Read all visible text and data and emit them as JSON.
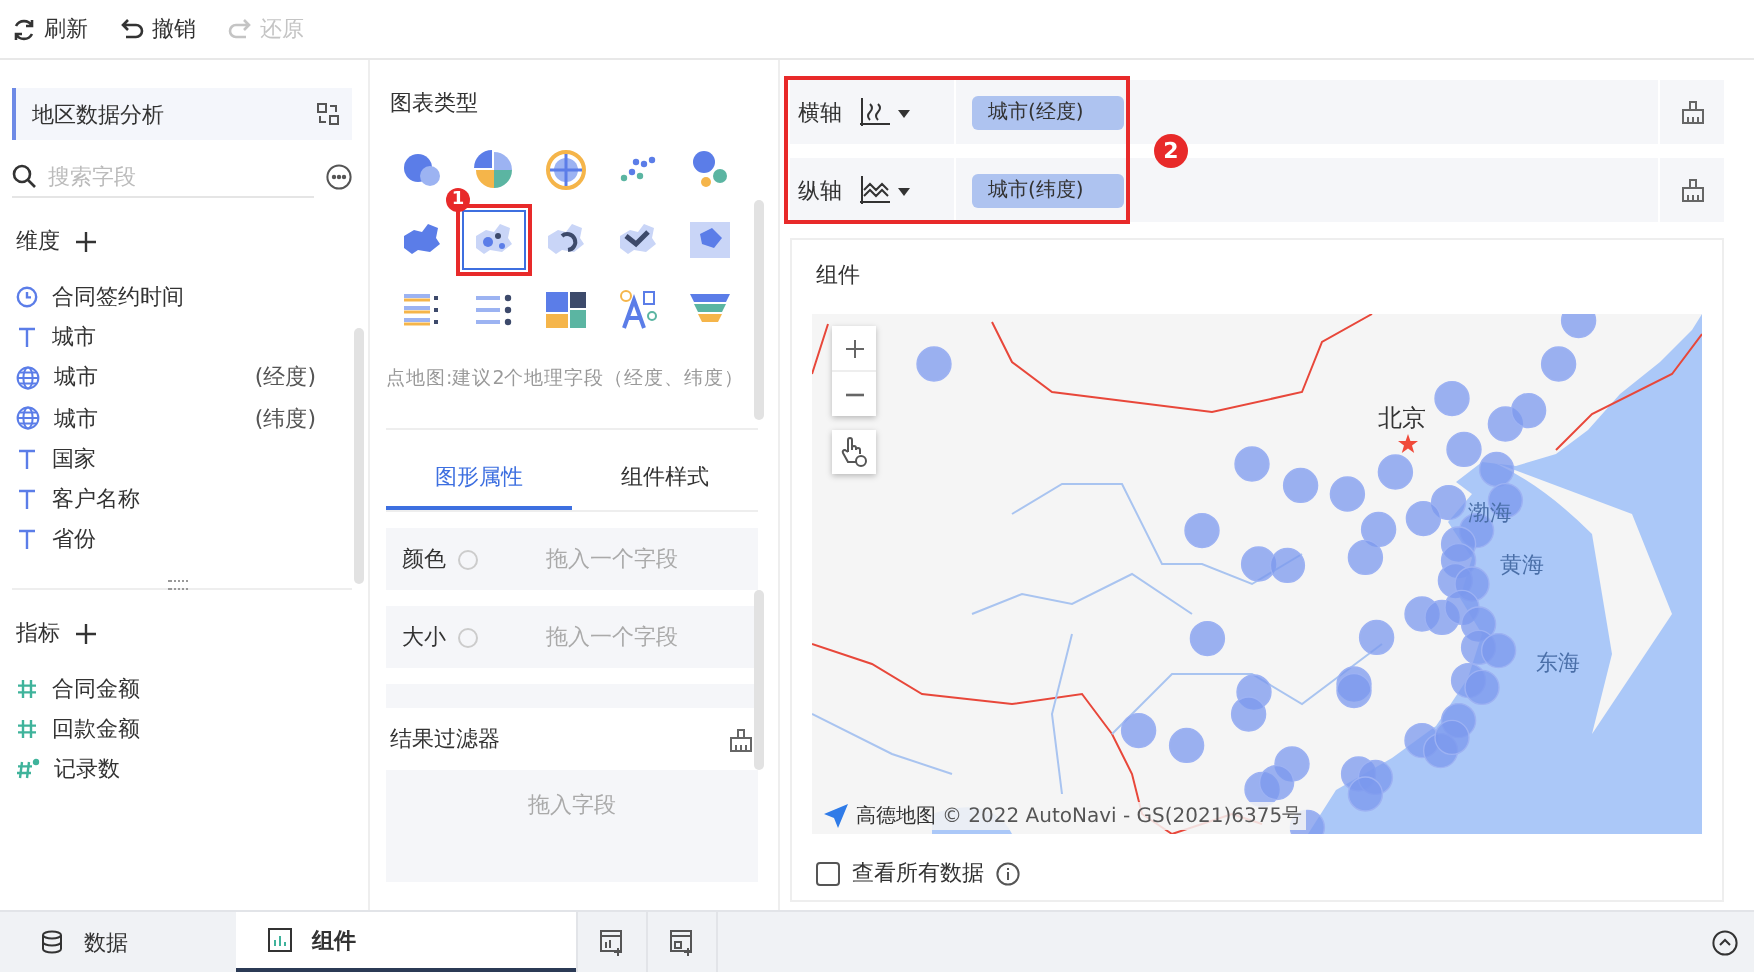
{
  "toolbar": {
    "buttons": [
      {
        "kind": "refresh",
        "label": "刷新",
        "disabled": false
      },
      {
        "kind": "undo",
        "label": "撤销",
        "disabled": false
      },
      {
        "kind": "redo",
        "label": "还原",
        "disabled": true
      }
    ]
  },
  "dataset": {
    "title": "地区数据分析"
  },
  "search": {
    "placeholder": "搜索字段"
  },
  "dimensions": {
    "title": "维度",
    "fields": [
      {
        "kind": "time",
        "name": "合同签约时间"
      },
      {
        "kind": "text",
        "name": "城市"
      },
      {
        "kind": "geo",
        "name": "城市",
        "suffix": "(经度)"
      },
      {
        "kind": "geo",
        "name": "城市",
        "suffix": "(纬度)"
      },
      {
        "kind": "text",
        "name": "国家"
      },
      {
        "kind": "text",
        "name": "客户名称"
      },
      {
        "kind": "text",
        "name": "省份"
      }
    ]
  },
  "measures": {
    "title": "指标",
    "fields": [
      {
        "kind": "number",
        "name": "合同金额"
      },
      {
        "kind": "number",
        "name": "回款金额"
      },
      {
        "kind": "count",
        "name": "记录数"
      }
    ]
  },
  "chart_types": {
    "title": "图表类型",
    "items": [
      {
        "selected": false
      },
      {
        "selected": false
      },
      {
        "selected": false
      },
      {
        "selected": false
      },
      {
        "selected": false
      },
      {
        "selected": false
      },
      {
        "selected": true
      },
      {
        "selected": false
      },
      {
        "selected": false
      },
      {
        "selected": false
      },
      {
        "selected": false
      },
      {
        "selected": false
      },
      {
        "selected": false
      },
      {
        "selected": false
      },
      {
        "selected": false
      }
    ],
    "hint": "点地图:建议2个地理字段（经度、纬度）"
  },
  "property_tabs": [
    {
      "label": "图形属性",
      "selected": true
    },
    {
      "label": "组件样式",
      "selected": false
    }
  ],
  "properties": [
    {
      "label": "颜色",
      "placeholder": "拖入一个字段"
    },
    {
      "label": "大小",
      "placeholder": "拖入一个字段"
    }
  ],
  "filter": {
    "title": "结果过滤器",
    "placeholder": "拖入字段"
  },
  "axes": [
    {
      "label": "横轴",
      "field": "城市(经度)"
    },
    {
      "label": "纵轴",
      "field": "城市(纬度)"
    }
  ],
  "callouts": [
    "1",
    "2"
  ],
  "component": {
    "title": "组件",
    "map_labels": [
      {
        "kind": "city",
        "text": "北京"
      },
      {
        "kind": "sea",
        "text": "渤海"
      },
      {
        "kind": "sea",
        "text": "黄海"
      },
      {
        "kind": "sea",
        "text": "东海"
      }
    ],
    "attribution": "高德地图",
    "copyright": "© 2022 AutoNavi - GS(2021)6375号",
    "show_all": {
      "label": "查看所有数据",
      "checked": false
    }
  },
  "bottom_tabs": [
    {
      "kind": "data",
      "label": "数据",
      "selected": false
    },
    {
      "kind": "component",
      "label": "组件",
      "selected": true
    }
  ]
}
